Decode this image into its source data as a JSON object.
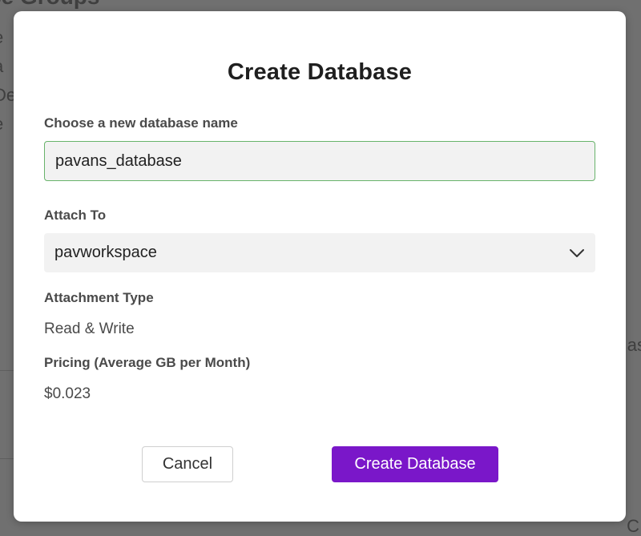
{
  "background": {
    "title_fragment": "ce Groups",
    "left_fragments": [
      "e",
      "a",
      "De",
      "e"
    ],
    "right_fragments": [
      "as",
      "C"
    ]
  },
  "dialog": {
    "title": "Create Database",
    "name_label": "Choose a new database name",
    "name_value": "pavans_database",
    "attach_label": "Attach To",
    "attach_value": "pavworkspace",
    "attach_icon": "chevron-down-icon",
    "attachment_type_label": "Attachment Type",
    "attachment_type_value": "Read & Write",
    "pricing_label": "Pricing (Average GB per Month)",
    "pricing_value": "$0.023",
    "cancel_label": "Cancel",
    "create_label": "Create Database"
  },
  "colors": {
    "primary": "#7a17c9",
    "input_focus_border": "#68b36b",
    "overlay": "#707070"
  }
}
